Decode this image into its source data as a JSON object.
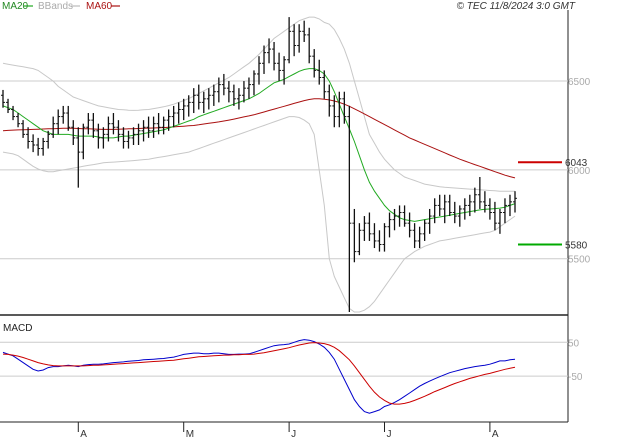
{
  "header": {
    "copyright": "© TEC 11/8/2024 3:0 GMT"
  },
  "legend": [
    {
      "label": "MA20",
      "color": "#22aa22"
    },
    {
      "label": "BBands",
      "color": "#bbbbbb"
    },
    {
      "label": "MA60",
      "color": "#aa1111"
    }
  ],
  "chart_data": [
    {
      "type": "line",
      "panel": "price",
      "y_ticks": [
        {
          "value": 6500,
          "label": "6500"
        },
        {
          "value": 6000,
          "label": "6000"
        },
        {
          "value": 5500,
          "label": "5500"
        }
      ],
      "ylim": [
        5200,
        6900
      ],
      "x_labels": [
        {
          "index": 15,
          "label": "A"
        },
        {
          "index": 36,
          "label": "M"
        },
        {
          "index": 57,
          "label": "J"
        },
        {
          "index": 76,
          "label": "J"
        },
        {
          "index": 97,
          "label": "A"
        }
      ],
      "levels": [
        {
          "name": "resistance",
          "value": 6043,
          "label": "6043",
          "color": "#cc0000"
        },
        {
          "name": "support",
          "value": 5580,
          "label": "5580",
          "color": "#00aa00"
        }
      ],
      "ohlc": [
        [
          6420,
          6450,
          6350,
          6380
        ],
        [
          6380,
          6400,
          6320,
          6340
        ],
        [
          6340,
          6360,
          6280,
          6300
        ],
        [
          6300,
          6320,
          6240,
          6260
        ],
        [
          6260,
          6280,
          6180,
          6200
        ],
        [
          6200,
          6240,
          6120,
          6160
        ],
        [
          6160,
          6200,
          6100,
          6140
        ],
        [
          6140,
          6180,
          6080,
          6120
        ],
        [
          6120,
          6180,
          6080,
          6160
        ],
        [
          6160,
          6220,
          6120,
          6200
        ],
        [
          6200,
          6300,
          6180,
          6260
        ],
        [
          6260,
          6340,
          6200,
          6300
        ],
        [
          6300,
          6360,
          6260,
          6320
        ],
        [
          6320,
          6360,
          6220,
          6240
        ],
        [
          6240,
          6280,
          6140,
          6180
        ],
        [
          6180,
          6240,
          5900,
          6100
        ],
        [
          6100,
          6260,
          6060,
          6240
        ],
        [
          6240,
          6320,
          6200,
          6280
        ],
        [
          6280,
          6320,
          6180,
          6220
        ],
        [
          6220,
          6260,
          6120,
          6180
        ],
        [
          6180,
          6240,
          6120,
          6200
        ],
        [
          6200,
          6300,
          6160,
          6260
        ],
        [
          6260,
          6320,
          6200,
          6240
        ],
        [
          6240,
          6280,
          6160,
          6200
        ],
        [
          6200,
          6240,
          6120,
          6160
        ],
        [
          6160,
          6220,
          6120,
          6180
        ],
        [
          6180,
          6240,
          6140,
          6200
        ],
        [
          6200,
          6260,
          6140,
          6220
        ],
        [
          6220,
          6280,
          6160,
          6240
        ],
        [
          6240,
          6300,
          6180,
          6220
        ],
        [
          6220,
          6300,
          6180,
          6260
        ],
        [
          6260,
          6320,
          6200,
          6240
        ],
        [
          6240,
          6300,
          6200,
          6280
        ],
        [
          6280,
          6340,
          6220,
          6300
        ],
        [
          6300,
          6360,
          6240,
          6320
        ],
        [
          6320,
          6380,
          6260,
          6340
        ],
        [
          6340,
          6400,
          6280,
          6360
        ],
        [
          6360,
          6420,
          6300,
          6380
        ],
        [
          6380,
          6460,
          6320,
          6420
        ],
        [
          6420,
          6480,
          6340,
          6380
        ],
        [
          6380,
          6440,
          6320,
          6400
        ],
        [
          6400,
          6460,
          6340,
          6420
        ],
        [
          6420,
          6480,
          6360,
          6440
        ],
        [
          6440,
          6520,
          6380,
          6480
        ],
        [
          6480,
          6540,
          6420,
          6460
        ],
        [
          6460,
          6500,
          6380,
          6440
        ],
        [
          6440,
          6480,
          6360,
          6400
        ],
        [
          6400,
          6460,
          6340,
          6420
        ],
        [
          6420,
          6500,
          6380,
          6460
        ],
        [
          6460,
          6520,
          6400,
          6480
        ],
        [
          6480,
          6560,
          6420,
          6540
        ],
        [
          6540,
          6640,
          6480,
          6600
        ],
        [
          6600,
          6700,
          6540,
          6660
        ],
        [
          6660,
          6740,
          6600,
          6680
        ],
        [
          6680,
          6720,
          6560,
          6600
        ],
        [
          6600,
          6660,
          6500,
          6560
        ],
        [
          6560,
          6640,
          6480,
          6620
        ],
        [
          6620,
          6860,
          6600,
          6780
        ],
        [
          6780,
          6820,
          6640,
          6700
        ],
        [
          6700,
          6820,
          6660,
          6780
        ],
        [
          6780,
          6840,
          6720,
          6760
        ],
        [
          6760,
          6800,
          6600,
          6640
        ],
        [
          6640,
          6680,
          6520,
          6560
        ],
        [
          6560,
          6620,
          6480,
          6520
        ],
        [
          6520,
          6560,
          6400,
          6440
        ],
        [
          6440,
          6480,
          6300,
          6360
        ],
        [
          6360,
          6420,
          6240,
          6300
        ],
        [
          6300,
          6440,
          6240,
          6400
        ],
        [
          6400,
          6440,
          6260,
          6300
        ],
        [
          6300,
          6360,
          5200,
          5700
        ],
        [
          5700,
          5780,
          5480,
          5540
        ],
        [
          5540,
          5700,
          5520,
          5660
        ],
        [
          5660,
          5740,
          5600,
          5700
        ],
        [
          5700,
          5760,
          5600,
          5640
        ],
        [
          5640,
          5700,
          5560,
          5600
        ],
        [
          5600,
          5660,
          5540,
          5580
        ],
        [
          5580,
          5700,
          5540,
          5680
        ],
        [
          5680,
          5760,
          5620,
          5720
        ],
        [
          5720,
          5780,
          5660,
          5740
        ],
        [
          5740,
          5800,
          5680,
          5760
        ],
        [
          5760,
          5800,
          5680,
          5700
        ],
        [
          5700,
          5760,
          5620,
          5660
        ],
        [
          5660,
          5700,
          5560,
          5600
        ],
        [
          5600,
          5680,
          5560,
          5640
        ],
        [
          5640,
          5720,
          5600,
          5700
        ],
        [
          5700,
          5780,
          5640,
          5740
        ],
        [
          5740,
          5840,
          5700,
          5800
        ],
        [
          5800,
          5860,
          5740,
          5780
        ],
        [
          5780,
          5860,
          5700,
          5820
        ],
        [
          5820,
          5860,
          5740,
          5760
        ],
        [
          5760,
          5820,
          5700,
          5740
        ],
        [
          5740,
          5800,
          5680,
          5780
        ],
        [
          5780,
          5840,
          5720,
          5800
        ],
        [
          5800,
          5860,
          5740,
          5820
        ],
        [
          5820,
          5900,
          5760,
          5860
        ],
        [
          5860,
          5960,
          5780,
          5820
        ],
        [
          5820,
          5880,
          5760,
          5800
        ],
        [
          5800,
          5840,
          5720,
          5760
        ],
        [
          5760,
          5820,
          5660,
          5700
        ],
        [
          5700,
          5780,
          5640,
          5760
        ],
        [
          5760,
          5840,
          5700,
          5800
        ],
        [
          5800,
          5860,
          5740,
          5820
        ],
        [
          5820,
          5880,
          5760,
          5840
        ]
      ],
      "ma20": [
        6360,
        6350,
        6340,
        6320,
        6300,
        6280,
        6260,
        6240,
        6220,
        6210,
        6200,
        6200,
        6200,
        6200,
        6195,
        6190,
        6190,
        6190,
        6190,
        6185,
        6180,
        6180,
        6180,
        6185,
        6190,
        6190,
        6195,
        6200,
        6205,
        6210,
        6215,
        6220,
        6225,
        6235,
        6245,
        6255,
        6265,
        6275,
        6285,
        6300,
        6310,
        6320,
        6330,
        6340,
        6350,
        6360,
        6370,
        6380,
        6390,
        6400,
        6415,
        6430,
        6450,
        6470,
        6490,
        6500,
        6510,
        6525,
        6540,
        6555,
        6565,
        6570,
        6570,
        6560,
        6540,
        6500,
        6440,
        6370,
        6300,
        6230,
        6160,
        6080,
        6000,
        5930,
        5880,
        5840,
        5800,
        5770,
        5750,
        5730,
        5720,
        5715,
        5710,
        5715,
        5720,
        5725,
        5730,
        5735,
        5740,
        5745,
        5750,
        5755,
        5760,
        5765,
        5770,
        5775,
        5778,
        5780,
        5782,
        5785,
        5790,
        5800,
        5810
      ],
      "ma60": [
        6220,
        6222,
        6224,
        6225,
        6226,
        6227,
        6228,
        6229,
        6230,
        6231,
        6232,
        6233,
        6234,
        6234,
        6234,
        6233,
        6232,
        6231,
        6230,
        6229,
        6228,
        6228,
        6228,
        6229,
        6230,
        6231,
        6232,
        6233,
        6234,
        6235,
        6236,
        6237,
        6238,
        6240,
        6242,
        6244,
        6246,
        6248,
        6250,
        6254,
        6258,
        6262,
        6266,
        6270,
        6275,
        6280,
        6286,
        6292,
        6298,
        6304,
        6310,
        6318,
        6326,
        6334,
        6342,
        6350,
        6358,
        6366,
        6374,
        6382,
        6390,
        6396,
        6400,
        6400,
        6398,
        6394,
        6388,
        6380,
        6370,
        6358,
        6344,
        6330,
        6315,
        6300,
        6285,
        6270,
        6255,
        6240,
        6225,
        6210,
        6195,
        6180,
        6168,
        6156,
        6144,
        6132,
        6120,
        6108,
        6096,
        6084,
        6072,
        6060,
        6050,
        6040,
        6030,
        6020,
        6010,
        6000,
        5990,
        5980,
        5970,
        5962,
        5955
      ],
      "bb_upper": [
        6600,
        6595,
        6590,
        6585,
        6580,
        6575,
        6570,
        6560,
        6540,
        6520,
        6500,
        6470,
        6450,
        6430,
        6410,
        6400,
        6390,
        6380,
        6370,
        6360,
        6355,
        6350,
        6345,
        6340,
        6338,
        6336,
        6335,
        6336,
        6338,
        6340,
        6345,
        6350,
        6355,
        6362,
        6370,
        6380,
        6390,
        6402,
        6415,
        6430,
        6445,
        6460,
        6475,
        6490,
        6505,
        6520,
        6540,
        6560,
        6580,
        6600,
        6625,
        6650,
        6680,
        6710,
        6740,
        6760,
        6780,
        6800,
        6820,
        6840,
        6850,
        6860,
        6860,
        6850,
        6830,
        6820,
        6790,
        6740,
        6680,
        6600,
        6500,
        6400,
        6300,
        6200,
        6150,
        6100,
        6060,
        6030,
        6000,
        5980,
        5960,
        5950,
        5940,
        5930,
        5920,
        5915,
        5910,
        5905,
        5902,
        5900,
        5898,
        5896,
        5894,
        5892,
        5890,
        5888,
        5886,
        5884,
        5882,
        5880,
        5880,
        5880,
        5880
      ],
      "bb_lower": [
        6100,
        6095,
        6090,
        6080,
        6060,
        6040,
        6020,
        6005,
        5995,
        5990,
        5990,
        5995,
        6000,
        6005,
        6010,
        6015,
        6020,
        6025,
        6030,
        6035,
        6040,
        6042,
        6044,
        6046,
        6048,
        6050,
        6052,
        6055,
        6058,
        6060,
        6065,
        6070,
        6075,
        6080,
        6085,
        6090,
        6095,
        6100,
        6110,
        6120,
        6130,
        6140,
        6150,
        6160,
        6170,
        6180,
        6190,
        6200,
        6210,
        6220,
        6230,
        6240,
        6250,
        6260,
        6270,
        6280,
        6290,
        6300,
        6300,
        6295,
        6280,
        6260,
        6200,
        6000,
        5800,
        5500,
        5400,
        5340,
        5280,
        5220,
        5200,
        5200,
        5210,
        5230,
        5260,
        5300,
        5340,
        5380,
        5420,
        5460,
        5500,
        5520,
        5540,
        5555,
        5570,
        5580,
        5590,
        5600,
        5605,
        5610,
        5615,
        5620,
        5625,
        5630,
        5635,
        5640,
        5645,
        5650,
        5660,
        5680,
        5700,
        5720,
        5740
      ]
    },
    {
      "type": "line",
      "panel": "macd",
      "title": "MACD",
      "y_ticks": [
        {
          "value": 50,
          "label": "50"
        },
        {
          "value": -50,
          "label": "-50"
        }
      ],
      "ylim": [
        -180,
        110
      ],
      "series": [
        {
          "name": "MACD",
          "color": "#0000cc",
          "values": [
            20,
            15,
            10,
            0,
            -10,
            -20,
            -30,
            -35,
            -32,
            -25,
            -22,
            -22,
            -20,
            -18,
            -20,
            -22,
            -18,
            -16,
            -15,
            -15,
            -14,
            -12,
            -10,
            -9,
            -8,
            -6,
            -5,
            -4,
            -2,
            -1,
            0,
            1,
            2,
            4,
            6,
            10,
            14,
            16,
            18,
            18,
            16,
            16,
            18,
            18,
            16,
            14,
            14,
            15,
            15,
            16,
            20,
            25,
            30,
            35,
            40,
            42,
            43,
            45,
            50,
            55,
            58,
            56,
            52,
            45,
            35,
            20,
            0,
            -30,
            -60,
            -90,
            -120,
            -140,
            -155,
            -160,
            -155,
            -150,
            -140,
            -135,
            -128,
            -120,
            -110,
            -100,
            -90,
            -80,
            -72,
            -65,
            -58,
            -52,
            -46,
            -40,
            -36,
            -32,
            -28,
            -25,
            -22,
            -20,
            -18,
            -15,
            -10,
            -5,
            -5,
            -2,
            0
          ]
        },
        {
          "name": "Signal",
          "color": "#cc0000",
          "values": [
            15,
            14,
            12,
            9,
            5,
            0,
            -5,
            -10,
            -14,
            -17,
            -19,
            -20,
            -20,
            -20,
            -20,
            -20,
            -20,
            -19,
            -18,
            -18,
            -17,
            -16,
            -15,
            -14,
            -13,
            -12,
            -11,
            -10,
            -9,
            -8,
            -7,
            -6,
            -5,
            -4,
            -3,
            -1,
            1,
            3,
            5,
            7,
            8,
            9,
            10,
            11,
            12,
            12,
            13,
            13,
            14,
            14,
            15,
            17,
            19,
            22,
            25,
            28,
            31,
            34,
            38,
            42,
            45,
            48,
            49,
            48,
            46,
            42,
            35,
            25,
            12,
            -2,
            -20,
            -40,
            -60,
            -80,
            -98,
            -112,
            -122,
            -130,
            -133,
            -133,
            -131,
            -127,
            -122,
            -116,
            -110,
            -103,
            -96,
            -90,
            -84,
            -78,
            -72,
            -67,
            -62,
            -57,
            -53,
            -49,
            -45,
            -42,
            -38,
            -34,
            -30,
            -27,
            -24
          ]
        }
      ]
    }
  ]
}
